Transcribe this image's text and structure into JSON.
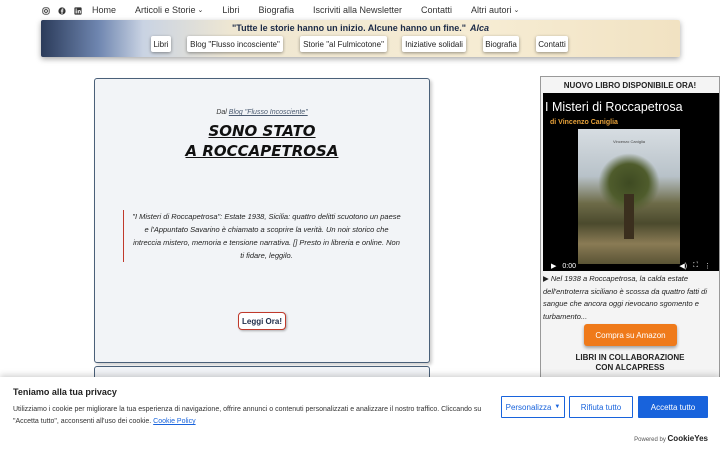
{
  "topnav": {
    "items": [
      {
        "label": "Home"
      },
      {
        "label": "Articoli e Storie",
        "dropdown": true
      },
      {
        "label": "Libri"
      },
      {
        "label": "Biografia"
      },
      {
        "label": "Iscriviti alla Newsletter"
      },
      {
        "label": "Contatti"
      },
      {
        "label": "Altri autori",
        "dropdown": true
      }
    ],
    "social_icons": [
      "instagram-icon",
      "facebook-icon",
      "linkedin-icon"
    ]
  },
  "banner": {
    "quote": "\"Tutte le storie hanno un inizio. Alcune hanno un fine.\"",
    "quote_author": "Alca",
    "menu": [
      "Libri",
      "Blog \"Flusso incosciente\"",
      "Storie \"al Fulmicotone\"",
      "Iniziative solidali",
      "Biografia",
      "Contatti"
    ]
  },
  "article": {
    "from_prefix": "Dal",
    "from_link": "Blog \"Flusso Incosciente\"",
    "headline_line1": "SONO STATO",
    "headline_line2": "A ROCCAPETROSA",
    "excerpt": "\"I Misteri di Roccapetrosa\": Estate 1938, Sicilia: quattro delitti scuotono un paese e l'Appuntato Savarino è chiamato a scoprire la verità. Un noir storico che intreccia mistero, memoria e tensione narrativa. [] Presto in libreria e online. Non ti fidare, leggilo.",
    "read_more": "Leggi Ora!"
  },
  "sidebar": {
    "title": "NUOVO LIBRO DISPONIBILE ORA!",
    "video_title": "I Misteri di Roccapetrosa",
    "video_author": "di Vincenzo Caniglia",
    "cover_author": "Vincenzo Caniglia",
    "cover_title": "I Misteri di Roccapetrosa",
    "time": "0:00",
    "blurb": "Nel 1938 a Roccapetrosa, la calda estate dell'entroterra siciliano è scossa da quattro fatti di sangue che ancora oggi rievocano sgomento e turbamento...",
    "amazon_button": "Compra su Amazon",
    "collab_line1": "LIBRI IN COLLABORAZIONE",
    "collab_line2": "CON ALCAPRESS"
  },
  "cookie": {
    "title": "Teniamo alla tua privacy",
    "text": "Utilizziamo i cookie per migliorare la tua esperienza di navigazione, offrire annunci o contenuti personalizzati e analizzare il nostro traffico. Cliccando su \"Accetta tutto\", acconsenti all'uso dei cookie.",
    "policy_link": "Cookie Policy",
    "customize": "Personalizza",
    "reject": "Rifiuta tutto",
    "accept": "Accetta tutto",
    "powered_prefix": "Powered by",
    "powered_brand": "CookieYes"
  },
  "colors": {
    "accent_red": "#c0392b",
    "amazon_orange": "#ef7a1a",
    "cookie_blue": "#1863dc"
  }
}
